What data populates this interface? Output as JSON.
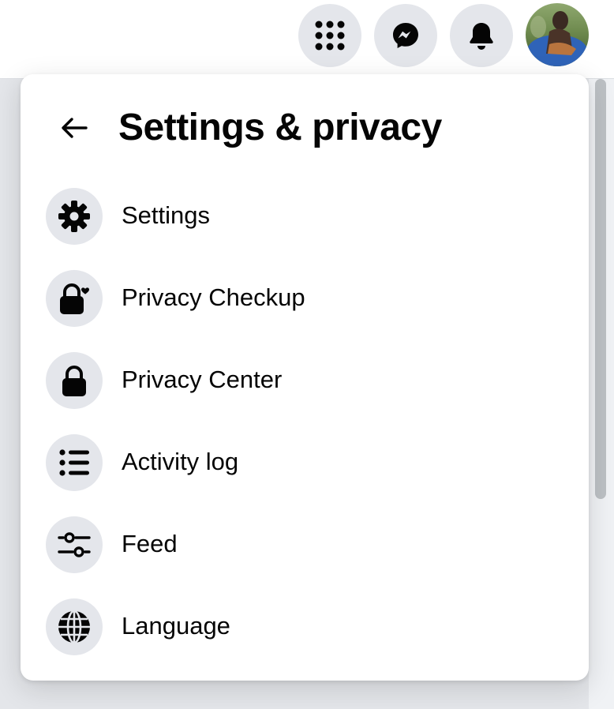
{
  "header": {
    "icons": [
      "menu-grid-icon",
      "messenger-icon",
      "bell-icon",
      "profile-avatar"
    ]
  },
  "settings_menu": {
    "title": "Settings & privacy",
    "back_icon": "arrow-left-icon",
    "items": [
      {
        "label": "Settings",
        "icon": "gear-icon"
      },
      {
        "label": "Privacy Checkup",
        "icon": "lock-heart-icon"
      },
      {
        "label": "Privacy Center",
        "icon": "lock-icon"
      },
      {
        "label": "Activity log",
        "icon": "list-icon"
      },
      {
        "label": "Feed",
        "icon": "sliders-icon"
      },
      {
        "label": "Language",
        "icon": "globe-icon"
      }
    ]
  },
  "colors": {
    "text_primary": "#050505",
    "icon_bg": "#e4e6eb",
    "backdrop": "#e4e6ea",
    "panel_bg": "#ffffff"
  }
}
